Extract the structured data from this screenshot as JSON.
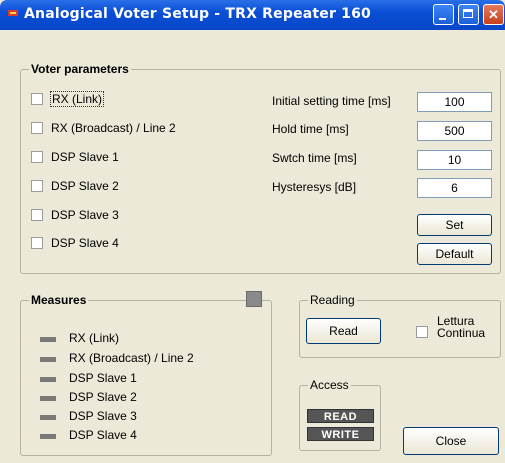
{
  "window": {
    "title": "Analogical Voter Setup - TRX Repeater 160",
    "controls": {
      "minimize": "minimize",
      "maximize": "maximize",
      "close": "✕"
    }
  },
  "voter_parameters": {
    "legend": "Voter parameters",
    "channels": [
      {
        "label": "RX (Link)",
        "checked": false
      },
      {
        "label": "RX (Broadcast) / Line 2",
        "checked": false
      },
      {
        "label": "DSP Slave 1",
        "checked": false
      },
      {
        "label": "DSP Slave 2",
        "checked": false
      },
      {
        "label": "DSP Slave 3",
        "checked": false
      },
      {
        "label": "DSP Slave 4",
        "checked": false
      }
    ],
    "params": [
      {
        "label": "Initial setting time [ms]",
        "value": "100"
      },
      {
        "label": "Hold time [ms]",
        "value": "500"
      },
      {
        "label": "Swtch time [ms]",
        "value": "10"
      },
      {
        "label": "Hysteresys [dB]",
        "value": "6"
      }
    ],
    "set_label": "Set",
    "default_label": "Default"
  },
  "measures": {
    "legend": "Measures",
    "items": [
      "RX (Link)",
      "RX (Broadcast) / Line 2",
      "DSP Slave 1",
      "DSP Slave 2",
      "DSP Slave 3",
      "DSP Slave 4"
    ]
  },
  "reading": {
    "legend": "Reading",
    "read_label": "Read",
    "continua_label_1": "Lettura",
    "continua_label_2": "Continua",
    "continua_checked": false
  },
  "access": {
    "legend": "Access",
    "read_tag": "READ",
    "write_tag": "WRITE"
  },
  "close_label": "Close",
  "colors": {
    "title_bar": "#0a4fd6",
    "window_bg": "#ece9d8",
    "led_off": "#7a7a7a",
    "access_tag": "#555555"
  }
}
